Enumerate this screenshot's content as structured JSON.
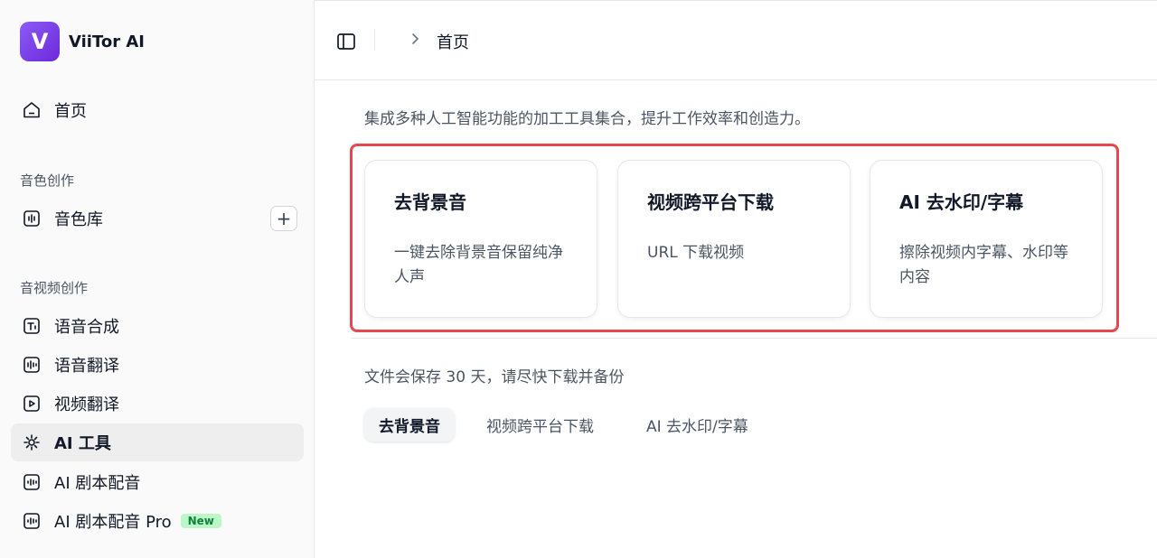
{
  "brand": {
    "name": "ViiTor AI",
    "logo_letter": "V",
    "logo_color": "#7c3aed"
  },
  "sidebar": {
    "home": {
      "label": "首页",
      "icon": "home-icon"
    },
    "sections": [
      {
        "title": "音色创作",
        "items": [
          {
            "label": "音色库",
            "icon": "voice-library-icon",
            "action": "+"
          }
        ]
      },
      {
        "title": "音视频创作",
        "items": [
          {
            "label": "语音合成",
            "icon": "tts-icon"
          },
          {
            "label": "语音翻译",
            "icon": "voice-translate-icon"
          },
          {
            "label": "视频翻译",
            "icon": "video-translate-icon"
          },
          {
            "label": "AI 工具",
            "icon": "ai-tools-icon",
            "active": true
          },
          {
            "label": "AI 剧本配音",
            "icon": "script-dubbing-icon"
          },
          {
            "label": "AI 剧本配音 Pro",
            "icon": "script-dubbing-pro-icon",
            "badge": "New"
          }
        ]
      }
    ]
  },
  "header": {
    "breadcrumb": "首页"
  },
  "main": {
    "intro": "集成多种人工智能功能的加工工具集合，提升工作效率和创造力。",
    "cards": [
      {
        "title": "去背景音",
        "desc": "一键去除背景音保留纯净人声"
      },
      {
        "title": "视频跨平台下载",
        "desc": "URL 下载视频"
      },
      {
        "title": "AI 去水印/字幕",
        "desc": "擦除视频内字幕、水印等内容"
      }
    ],
    "note": "文件会保存 30 天，请尽快下载并备份",
    "tabs": [
      {
        "label": "去背景音",
        "active": true
      },
      {
        "label": "视频跨平台下载"
      },
      {
        "label": "AI 去水印/字幕"
      }
    ]
  },
  "colors": {
    "highlight_border": "#e5484d",
    "badge_bg": "#bbf7c8",
    "badge_text": "#15803d"
  }
}
